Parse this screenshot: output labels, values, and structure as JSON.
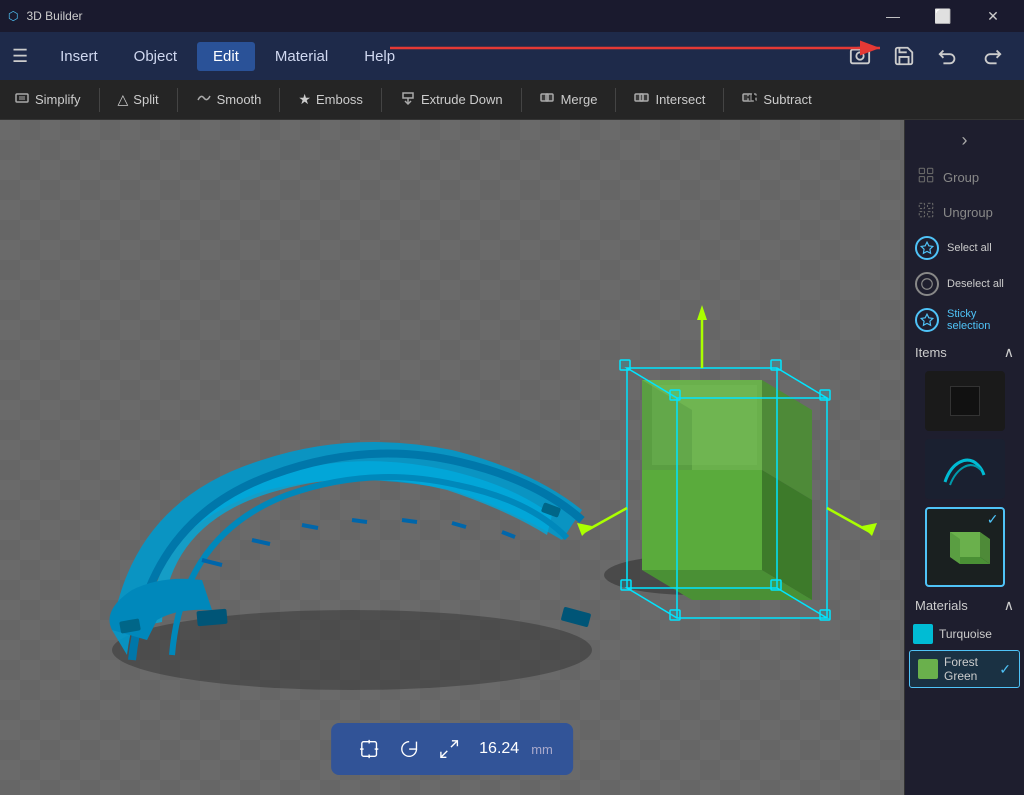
{
  "app": {
    "title": "3D Builder",
    "titlebar": {
      "minimize": "—",
      "restore": "⬜",
      "close": "✕"
    }
  },
  "menubar": {
    "hamburger": "☰",
    "items": [
      {
        "id": "insert",
        "label": "Insert"
      },
      {
        "id": "object",
        "label": "Object"
      },
      {
        "id": "edit",
        "label": "Edit",
        "active": true
      },
      {
        "id": "material",
        "label": "Material"
      },
      {
        "id": "help",
        "label": "Help"
      }
    ],
    "right_icons": [
      "📷",
      "💾",
      "↩",
      "↪"
    ]
  },
  "toolbar": {
    "tools": [
      {
        "id": "simplify",
        "icon": "⬛",
        "label": "Simplify"
      },
      {
        "id": "split",
        "icon": "△",
        "label": "Split"
      },
      {
        "id": "smooth",
        "icon": "~",
        "label": "Smooth"
      },
      {
        "id": "emboss",
        "icon": "★",
        "label": "Emboss"
      },
      {
        "id": "extrude-down",
        "icon": "⬇",
        "label": "Extrude Down"
      },
      {
        "id": "merge",
        "icon": "⬛",
        "label": "Merge"
      },
      {
        "id": "intersect",
        "icon": "⬛",
        "label": "Intersect"
      },
      {
        "id": "subtract",
        "icon": "⬛",
        "label": "Subtract"
      }
    ]
  },
  "viewport": {
    "bottom_toolbar": {
      "move_icon": "⛶",
      "rotate_icon": "↺",
      "scale_icon": "⤢",
      "size": "16.24",
      "unit": "mm"
    }
  },
  "right_panel": {
    "collapse_icon": "›",
    "group_label": "Group",
    "ungroup_label": "Ungroup",
    "select_all_label": "Select all",
    "deselect_all_label": "Deselect all",
    "sticky_selection_label": "Sticky selection",
    "items_section": "Items",
    "materials_section": "Materials",
    "materials": [
      {
        "id": "turquoise",
        "label": "Turquoise",
        "color": "#00bcd4",
        "selected": false
      },
      {
        "id": "forest-green",
        "label": "Forest Green",
        "color": "#6ab04c",
        "selected": true
      }
    ]
  }
}
